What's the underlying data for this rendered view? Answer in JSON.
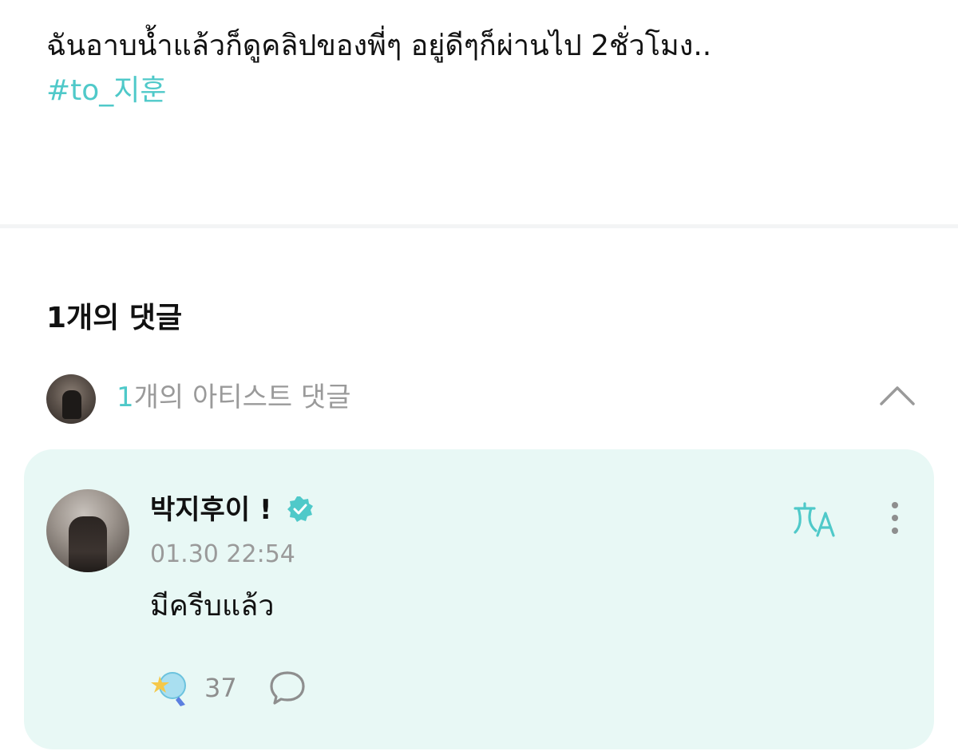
{
  "post": {
    "text": "ฉันอาบน้ำแล้วก็ดูคลิปของพี่ๆ อยู่ดีๆก็ผ่านไป 2ชั่วโมง..",
    "hashtag": "#to_지훈"
  },
  "comments": {
    "count_label": "1개의 댓글",
    "artist_section": {
      "count": "1",
      "label": "개의 아티스트 댓글",
      "collapse_icon": "chevron-up-icon"
    },
    "items": [
      {
        "author": "박지후이 !",
        "verified_icon": "verified-badge-icon",
        "timestamp": "01.30 22:54",
        "text": "มีครีบแล้ว",
        "cheer_count": "37",
        "icons": {
          "translate": "translate-icon",
          "more": "more-vertical-icon",
          "cheer": "cheer-icon",
          "reply": "reply-bubble-icon"
        }
      }
    ]
  },
  "colors": {
    "accent": "#4fc9c9",
    "card_background": "#e8f8f5",
    "muted_text": "#9a9a9a"
  }
}
